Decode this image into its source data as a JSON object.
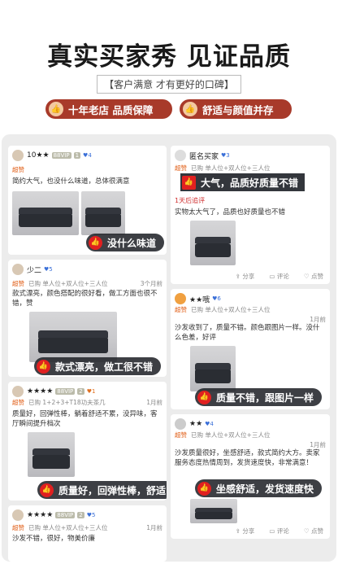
{
  "header": {
    "title": "真实买家秀 见证品质",
    "subtitle": "【客户满意 才有更好的口碑】",
    "badges": [
      {
        "label": "十年老店 品质保障",
        "icon": "thumbs-up-icon"
      },
      {
        "label": "舒适与颜值并存",
        "icon": "thumbs-up-icon"
      }
    ]
  },
  "common": {
    "good_label": "超赞",
    "share": "分享",
    "comment": "评论",
    "like": "点赞"
  },
  "reviews": [
    {
      "user": "10★★",
      "vip": "88VIP",
      "vip_level": "1",
      "level": "4",
      "text": "简约大气，也没什么味道，总体很满意",
      "banner": "没什么味道"
    },
    {
      "user": "少二",
      "level": "5",
      "spec": "已购 单人位+双人位+三人位",
      "date": "3个月前",
      "text": "款式漂亮，颜色搭配的很好看，做工方面也很不错，赞",
      "banner": "款式漂亮，做工很不错"
    },
    {
      "user": "★★★★",
      "vip": "88VIP",
      "vip_level": "2",
      "level": "1",
      "spec": "已购 1+2+3+T18功夫茶几",
      "date": "1月前",
      "text": "质量好，回弹性棒，躺着舒适不累，没异味，客厅瞬间提升档次",
      "banner": "质量好，回弹性棒，舒适"
    },
    {
      "user": "★★★★",
      "vip": "88VIP",
      "vip_level": "2",
      "level": "5",
      "spec": "已购 单人位+双人位+三人位",
      "date": "1月前",
      "text": "沙发不错，很好，物美价廉"
    },
    {
      "user": "匿名买家",
      "level": "3",
      "spec": "已购 单人位+双人位+三人位",
      "banner": "大气，品质好质量不错",
      "tag": "1天后追评",
      "text": "实物太大气了，品质也好质量也不错"
    },
    {
      "user": "★★哦",
      "level": "6",
      "spec": "已购 单人位+双人位+三人位",
      "date": "1月前",
      "text": "沙发收到了，质量不错。颜色跟图片一样。没什么色差，好评",
      "banner": "质量不错，跟图片一样"
    },
    {
      "user": "★★",
      "level": "4",
      "spec": "已购 单人位+双人位+三人位",
      "date": "1月前",
      "text": "沙发质量很好，坐感舒适，款式简约大方。卖家服务态度热情周到，发货速度快，非常满意！",
      "banner": "坐感舒适，发货速度快"
    }
  ]
}
